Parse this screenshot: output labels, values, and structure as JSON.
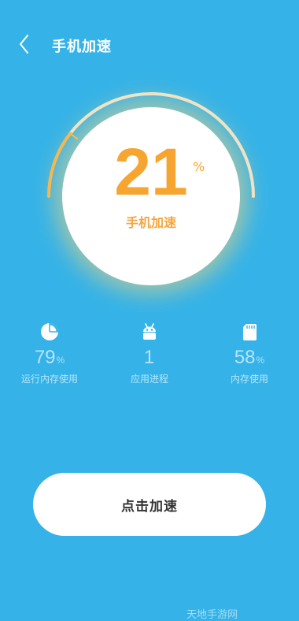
{
  "header": {
    "title": "手机加速",
    "back_icon": "chevron-left-icon"
  },
  "gauge": {
    "percent": "21",
    "percent_unit": "%",
    "label": "手机加速",
    "progress_fraction": 0.21
  },
  "stats": [
    {
      "icon": "pie-chart-icon",
      "value": "79",
      "unit": "%",
      "label": "运行内存使用"
    },
    {
      "icon": "android-icon",
      "value": "1",
      "unit": "",
      "label": "应用进程"
    },
    {
      "icon": "sd-card-icon",
      "value": "58",
      "unit": "%",
      "label": "内存使用"
    }
  ],
  "action": {
    "label": "点击加速"
  },
  "watermark": "天地手游网",
  "colors": {
    "background": "#35b3e8",
    "accent": "#f6a530",
    "track": "#efe6d2"
  }
}
